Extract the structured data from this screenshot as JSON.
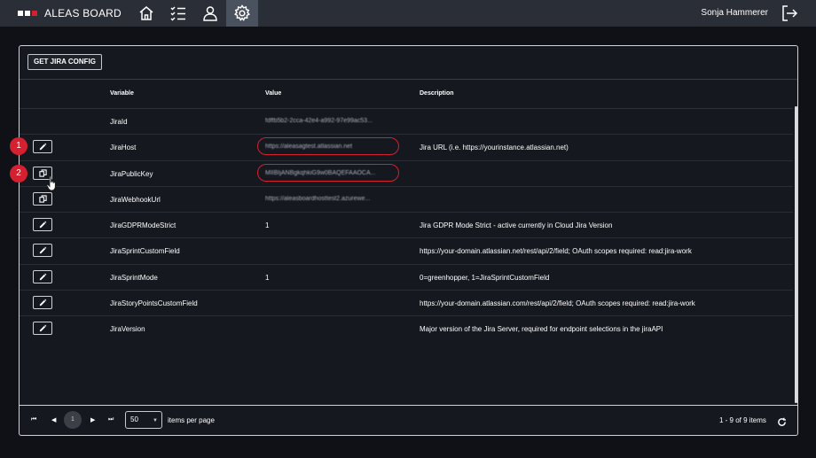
{
  "app": {
    "brand": "ALEAS BOARD",
    "user_name": "Sonja Hammerer"
  },
  "nav": [
    "home-icon",
    "checklist-icon",
    "user-icon",
    "settings-icon"
  ],
  "toolbar": {
    "get_config_label": "GET JIRA CONFIG"
  },
  "table": {
    "headers": {
      "variable": "Variable",
      "value": "Value",
      "description": "Description"
    },
    "rows": [
      {
        "variable": "JiraId",
        "value": "fdffb5b2-2cca-42e4-a992-97e99ac53...",
        "description": "",
        "action": "none",
        "value_blurred": true
      },
      {
        "variable": "JiraHost",
        "value": "https://aleasagtest.atlassian.net",
        "description": "Jira URL (i.e. https://yourinstance.atlassian.net)",
        "action": "edit-icon",
        "value_blurred": true
      },
      {
        "variable": "JiraPublicKey",
        "value": "MIIBIjANBgkqhkiG9w0BAQEFAAOCA...",
        "description": "",
        "action": "copy-icon",
        "value_blurred": true
      },
      {
        "variable": "JiraWebhookUrl",
        "value": "https://aleasboardhosttest2.azurewe...",
        "description": "",
        "action": "copy-icon",
        "value_blurred": true
      },
      {
        "variable": "JiraGDPRModeStrict",
        "value": "1",
        "description": "Jira GDPR Mode Strict - active currently in Cloud Jira Version",
        "action": "edit-icon",
        "value_blurred": false
      },
      {
        "variable": "JiraSprintCustomField",
        "value": "",
        "description": "https://your-domain.atlassian.net/rest/api/2/field; OAuth scopes required: read:jira-work",
        "action": "edit-icon",
        "value_blurred": false
      },
      {
        "variable": "JiraSprintMode",
        "value": "1",
        "description": "0=greenhopper, 1=JiraSprintCustomField",
        "action": "edit-icon",
        "value_blurred": false
      },
      {
        "variable": "JiraStoryPointsCustomField",
        "value": "",
        "description": "https://your-domain.atlassian.com/rest/api/2/field; OAuth scopes required: read:jira-work",
        "action": "edit-icon",
        "value_blurred": false
      },
      {
        "variable": "JiraVersion",
        "value": "",
        "description": "Major version of the Jira Server, required for endpoint selections in the jiraAPI",
        "action": "edit-icon",
        "value_blurred": false
      }
    ]
  },
  "pagination": {
    "current_page": "1",
    "per_page": "50",
    "per_page_label": "items per page",
    "range_label": "1 - 9 of 9 items"
  },
  "markers": [
    "1",
    "2"
  ],
  "colors": {
    "accent": "#d4202f",
    "topbar": "#2a2e37",
    "active_tab": "#4a5260",
    "background": "#0f1116"
  }
}
